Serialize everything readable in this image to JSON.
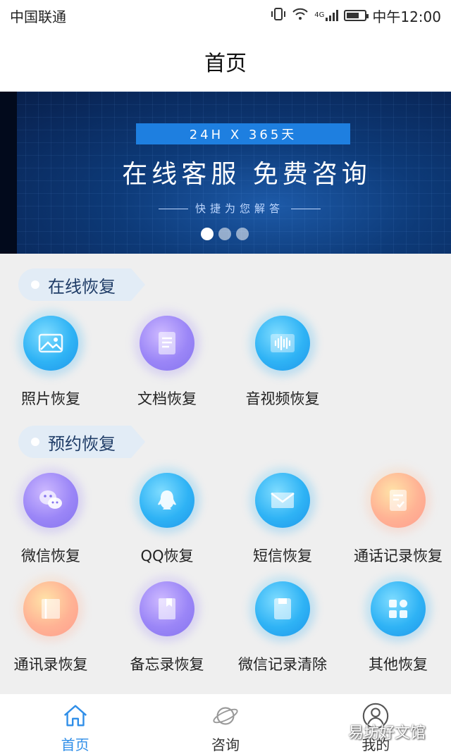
{
  "status_bar": {
    "carrier": "中国联通",
    "network": "4G",
    "time": "中午12:00"
  },
  "header": {
    "title": "首页"
  },
  "banner": {
    "tag": "24H X 365天",
    "headline": "在线客服 免费咨询",
    "subline": "快捷为您解答",
    "dots": 3,
    "active_dot": 0
  },
  "sections": [
    {
      "title": "在线恢复",
      "items": [
        {
          "label": "照片恢复",
          "icon": "image-icon",
          "color": "#2fb3f5"
        },
        {
          "label": "文档恢复",
          "icon": "document-icon",
          "color": "#9b86f7"
        },
        {
          "label": "音视频恢复",
          "icon": "audio-wave-icon",
          "color": "#2fb3f5"
        }
      ]
    },
    {
      "title": "预约恢复",
      "items": [
        {
          "label": "微信恢复",
          "icon": "wechat-icon",
          "color": "#9b86f7"
        },
        {
          "label": "QQ恢复",
          "icon": "qq-penguin-icon",
          "color": "#2fb3f5"
        },
        {
          "label": "短信恢复",
          "icon": "envelope-icon",
          "color": "#2fb3f5"
        },
        {
          "label": "通话记录恢复",
          "icon": "call-log-icon",
          "color": "#ffb294"
        },
        {
          "label": "通讯录恢复",
          "icon": "contacts-icon",
          "color": "#ffb294"
        },
        {
          "label": "备忘录恢复",
          "icon": "memo-book-icon",
          "color": "#9b86f7"
        },
        {
          "label": "微信记录清除",
          "icon": "clean-icon",
          "color": "#2fb3f5"
        },
        {
          "label": "其他恢复",
          "icon": "grid-apps-icon",
          "color": "#2fb3f5"
        }
      ]
    }
  ],
  "bottom_nav": [
    {
      "label": "首页",
      "icon": "home-icon",
      "active": true,
      "color": "#2f8ee8"
    },
    {
      "label": "咨询",
      "icon": "planet-icon",
      "active": false
    },
    {
      "label": "我的",
      "icon": "user-icon",
      "active": false
    }
  ],
  "watermark": "易坊好文馆"
}
